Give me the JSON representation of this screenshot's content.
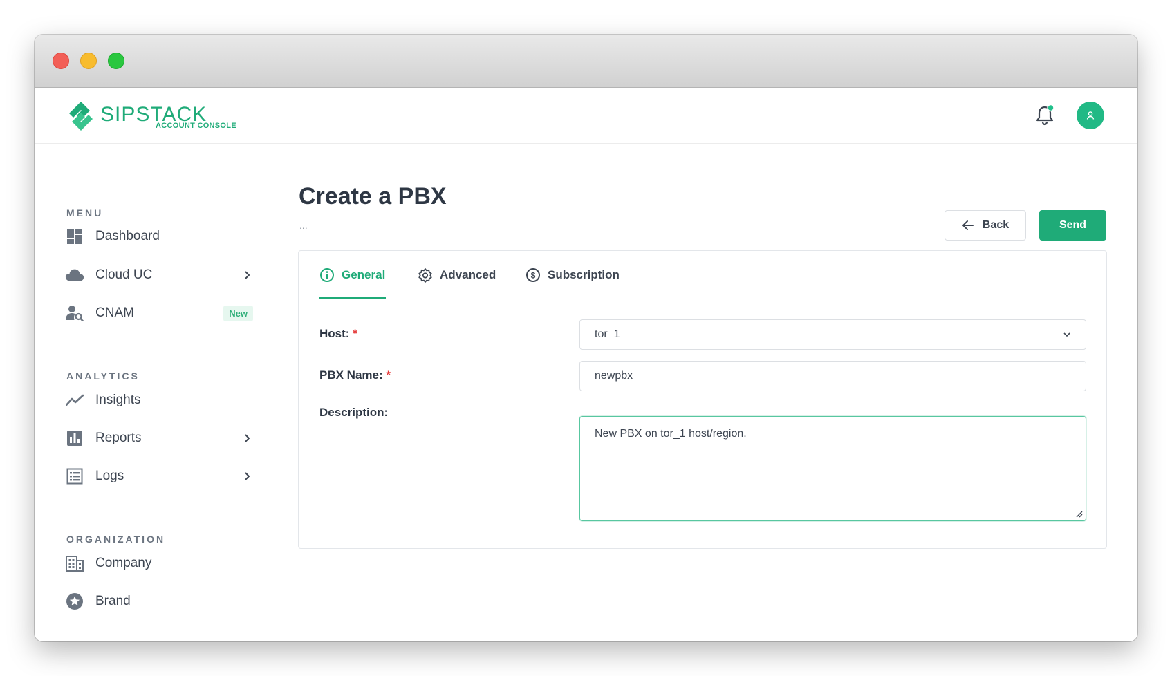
{
  "brand": {
    "name": "SIPSTACK",
    "subtitle": "ACCOUNT CONSOLE",
    "color": "#1fab78"
  },
  "header": {
    "notification_icon": "bell-icon",
    "avatar_icon": "user-icon"
  },
  "sidebar": {
    "sections": [
      {
        "title": "MENU"
      },
      {
        "title": "ANALYTICS"
      },
      {
        "title": "ORGANIZATION"
      }
    ],
    "items": [
      {
        "label": "Dashboard",
        "icon": "dashboard-icon"
      },
      {
        "label": "Cloud UC",
        "icon": "cloud-icon",
        "expandable": true
      },
      {
        "label": "CNAM",
        "icon": "user-search-icon",
        "badge": "New"
      },
      {
        "label": "Insights",
        "icon": "trend-icon"
      },
      {
        "label": "Reports",
        "icon": "bar-chart-icon",
        "expandable": true
      },
      {
        "label": "Logs",
        "icon": "list-icon",
        "expandable": true
      },
      {
        "label": "Company",
        "icon": "building-icon"
      },
      {
        "label": "Brand",
        "icon": "star-icon"
      }
    ]
  },
  "page": {
    "title": "Create a PBX",
    "breadcrumb": "...",
    "back_label": "Back",
    "send_label": "Send"
  },
  "tabs": [
    {
      "label": "General",
      "icon": "info-icon",
      "active": true
    },
    {
      "label": "Advanced",
      "icon": "gear-icon",
      "active": false
    },
    {
      "label": "Subscription",
      "icon": "dollar-icon",
      "active": false
    }
  ],
  "form": {
    "host": {
      "label": "Host:",
      "required": "*",
      "value": "tor_1"
    },
    "pbx_name": {
      "label": "PBX Name:",
      "required": "*",
      "value": "newpbx"
    },
    "description": {
      "label": "Description:",
      "value": "New PBX on tor_1 host/region."
    }
  }
}
